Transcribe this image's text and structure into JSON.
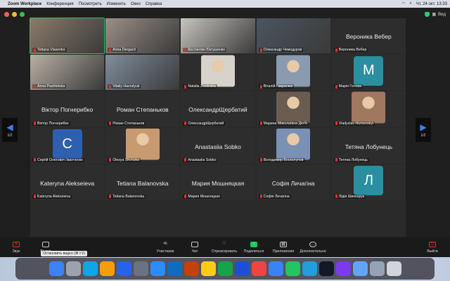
{
  "menubar": {
    "app": "Zoom Workplace",
    "items": [
      "Конференция",
      "Посмотреть",
      "Изменить",
      "Окно",
      "Справка"
    ],
    "datetime": "Чт, 24 окт. 13:33"
  },
  "titlebar": {
    "view_label": "Вид"
  },
  "tiles": [
    {
      "name": "Tetiana Vlasenko",
      "type": "video",
      "color": "#8a7b6a",
      "active": true
    },
    {
      "name": "Anna Dergach",
      "type": "video",
      "color": "#9a8f86"
    },
    {
      "name": "Костянтин Євтушенко",
      "type": "video",
      "color": "#c8c4bd"
    },
    {
      "name": "Олександр Чемодуров",
      "type": "video",
      "color": "#4b5560"
    },
    {
      "name": "Вероника Вебер",
      "type": "name",
      "big": "Вероника Вебер"
    },
    {
      "name": "Anna Pashtetska",
      "type": "video",
      "color": "#b8b0a5"
    },
    {
      "name": "Vitaliy Havrulyuk",
      "type": "video",
      "color": "#7f8d9c"
    },
    {
      "name": "Natalia Zvolinska",
      "type": "photo",
      "color": "#d7d2cb"
    },
    {
      "name": "Віталій Гаврилюк",
      "type": "photo",
      "color": "#8a9bb0"
    },
    {
      "name": "Марія Голова",
      "type": "avatar",
      "letter": "M",
      "color": "#2a8fa0"
    },
    {
      "name": "Віктор Погнерибко",
      "type": "name",
      "big": "Віктор Погнерибко"
    },
    {
      "name": "Роман Степаньков",
      "type": "name",
      "big": "Роман Степаньков"
    },
    {
      "name": "ОлександрЩербатий",
      "type": "name",
      "big": "ОлександрЩербатий"
    },
    {
      "name": "Марина Миколаївна Дегбі",
      "type": "photo",
      "color": "#6b5c52"
    },
    {
      "name": "Vladyslav Humenskyi",
      "type": "photo",
      "color": "#a07860"
    },
    {
      "name": "Сергій Олегович Іванченко",
      "type": "avatar",
      "letter": "C",
      "color": "#2f5fb0"
    },
    {
      "name": "Olesya Shchuka",
      "type": "photo",
      "color": "#c89a70"
    },
    {
      "name": "Anastasiia Sobko",
      "type": "name",
      "big": "Anastasiia Sobko"
    },
    {
      "name": "Володимир Восколупов",
      "type": "photo",
      "color": "#7a90b5"
    },
    {
      "name": "Тетяна Лобунець",
      "type": "name",
      "big": "Тетяна Лобунець"
    },
    {
      "name": "Kateryna Alekseieva",
      "type": "name",
      "big": "Kateryna Alekseieva"
    },
    {
      "name": "Tetiana Balanovska",
      "type": "name",
      "big": "Tetiana Balanovska"
    },
    {
      "name": "Мария Мошняцкая",
      "type": "name",
      "big": "Мария Мошняцкая"
    },
    {
      "name": "Софія Личагіна",
      "type": "name",
      "big": "Софія Личагіна"
    },
    {
      "name": "Лідія Шинкарук",
      "type": "avatar",
      "letter": "Л",
      "color": "#2a8fa0"
    }
  ],
  "pager": {
    "left": "1/2",
    "right": "1/2"
  },
  "toolbar": {
    "sound": "Звук",
    "video": "Видео",
    "participants": "Участники",
    "participants_count": "46",
    "chat": "Чат",
    "react": "Отреагировать",
    "share": "Поделиться",
    "apps": "Приложения",
    "more": "Дополнительно",
    "leave": "Выйти"
  },
  "tooltip": "Остановить видео (⌘⇧V)",
  "dock": [
    "Finder",
    "Launchpad",
    "Safari",
    "Photos",
    "App Store",
    "Settings",
    "Zoom",
    "Outlook",
    "PowerPoint",
    "Notes",
    "Excel",
    "Word",
    "Music",
    "Mail",
    "Chrome",
    "Telegram",
    "Terminal",
    "Viber",
    "Preview",
    "Downloads",
    "Trash"
  ]
}
